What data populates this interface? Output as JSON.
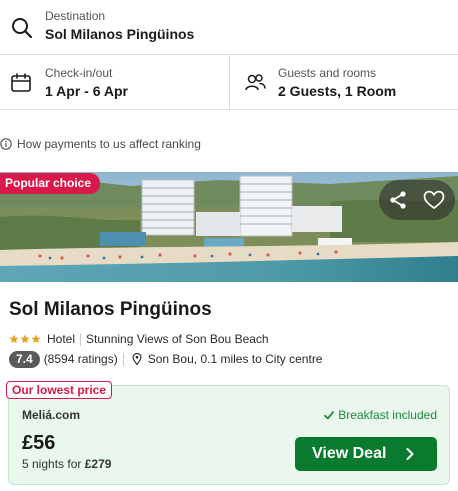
{
  "search": {
    "destination_label": "Destination",
    "destination_value": "Sol Milanos Pingüinos",
    "checkin_label": "Check-in/out",
    "checkin_value": "1 Apr - 6 Apr",
    "guests_label": "Guests and rooms",
    "guests_value": "2 Guests, 1 Room"
  },
  "ranking_note": "How payments to us affect ranking",
  "hotel": {
    "badge": "Popular choice",
    "name": "Sol Milanos Pingüinos",
    "stars": 3,
    "type": "Hotel",
    "feature": "Stunning Views of Son Bou Beach",
    "score": "7.4",
    "ratings": "(8594 ratings)",
    "location": "Son Bou, 0.1 miles to City centre"
  },
  "deal": {
    "tag": "Our lowest price",
    "provider": "Meliá.com",
    "breakfast": "Breakfast included",
    "price": "£56",
    "nights_prefix": "5 nights for",
    "nights_total": "£279",
    "button": "View Deal"
  },
  "colors": {
    "accent_red": "#d8194a",
    "deal_green": "#0a7a2e",
    "deal_bg": "#eaf7ed",
    "star": "#e8a21c"
  },
  "icons": {
    "destination": "search-icon",
    "dates": "calendar-icon",
    "guests": "guests-icon",
    "info": "info-icon",
    "share": "share-icon",
    "favorite": "heart-icon",
    "location": "location-pin-icon",
    "check": "check-icon",
    "chevron": "chevron-right-icon"
  }
}
